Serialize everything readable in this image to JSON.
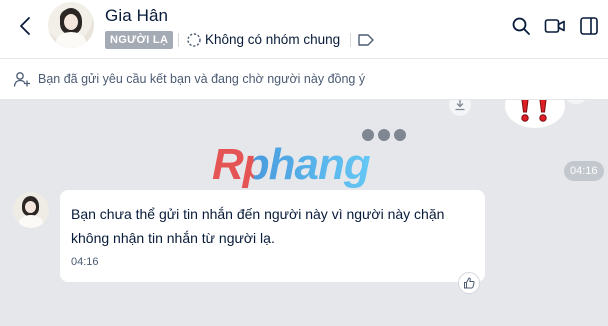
{
  "header": {
    "contact_name": "Gia Hân",
    "stranger_badge": "NGƯỜI LẠ",
    "common_groups": "Không có nhóm chung"
  },
  "notice": {
    "text": "Bạn đã gửi yêu cầu kết bạn và đang chờ người này đồng ý"
  },
  "chat": {
    "divider_time": "04:16",
    "watermark": "Rphang",
    "message": {
      "text": "Bạn chưa thể gửi tin nhắn đến người này vì người này chặn không nhận tin nhắn từ người lạ.",
      "time": "04:16"
    }
  },
  "colors": {
    "badge_bg": "#a4abb5",
    "chat_bg": "#e5e7eb",
    "text_primary": "#081b3a",
    "text_secondary": "#4b5b73"
  },
  "icons": {
    "back": "chevron-left-icon",
    "group": "dashed-circle-icon",
    "tag": "tag-icon",
    "search": "search-icon",
    "video": "video-call-icon",
    "panel": "sidebar-toggle-icon",
    "add_friend": "user-add-icon",
    "download": "download-icon",
    "like": "thumbs-up-icon"
  }
}
